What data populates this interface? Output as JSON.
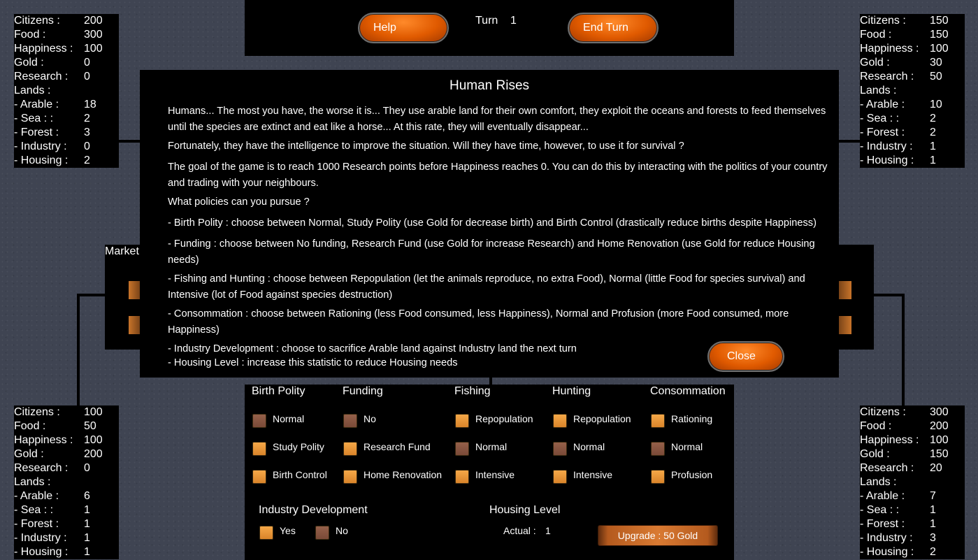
{
  "top": {
    "help_label": "Help",
    "turn_label": "Turn",
    "turn_value": "1",
    "end_turn_label": "End Turn"
  },
  "panels": {
    "top_left": {
      "rows": [
        {
          "k": "Citizens :",
          "v": "200"
        },
        {
          "k": "Food :",
          "v": "300"
        },
        {
          "k": "Happiness :",
          "v": "100"
        },
        {
          "k": "Gold :",
          "v": "0"
        },
        {
          "k": "Research :",
          "v": "0"
        },
        {
          "k": "Lands :",
          "v": ""
        },
        {
          "k": "- Arable :",
          "v": "18"
        },
        {
          "k": "- Sea : :",
          "v": "2"
        },
        {
          "k": "- Forest :",
          "v": "3"
        },
        {
          "k": "- Industry :",
          "v": "0"
        },
        {
          "k": "- Housing :",
          "v": "2"
        }
      ]
    },
    "top_right": {
      "rows": [
        {
          "k": "Citizens :",
          "v": "150"
        },
        {
          "k": "Food :",
          "v": "150"
        },
        {
          "k": "Happiness :",
          "v": "100"
        },
        {
          "k": "Gold :",
          "v": "30"
        },
        {
          "k": "Research :",
          "v": "50"
        },
        {
          "k": "Lands :",
          "v": ""
        },
        {
          "k": "- Arable :",
          "v": "10"
        },
        {
          "k": "- Sea : :",
          "v": "2"
        },
        {
          "k": "- Forest :",
          "v": "2"
        },
        {
          "k": "- Industry :",
          "v": "1"
        },
        {
          "k": "- Housing :",
          "v": "1"
        }
      ]
    },
    "bottom_left": {
      "rows": [
        {
          "k": "Citizens :",
          "v": "100"
        },
        {
          "k": "Food :",
          "v": "50"
        },
        {
          "k": "Happiness :",
          "v": "100"
        },
        {
          "k": "Gold :",
          "v": "200"
        },
        {
          "k": "Research :",
          "v": "0"
        },
        {
          "k": "Lands :",
          "v": ""
        },
        {
          "k": "- Arable :",
          "v": "6"
        },
        {
          "k": "- Sea : :",
          "v": "1"
        },
        {
          "k": "- Forest :",
          "v": "1"
        },
        {
          "k": "- Industry :",
          "v": "1"
        },
        {
          "k": "- Housing :",
          "v": "1"
        }
      ]
    },
    "bottom_right": {
      "rows": [
        {
          "k": "Citizens :",
          "v": "300"
        },
        {
          "k": "Food :",
          "v": "200"
        },
        {
          "k": "Happiness :",
          "v": "100"
        },
        {
          "k": "Gold :",
          "v": "150"
        },
        {
          "k": "Research :",
          "v": "20"
        },
        {
          "k": "Lands :",
          "v": ""
        },
        {
          "k": "- Arable :",
          "v": "7"
        },
        {
          "k": "- Sea : :",
          "v": "1"
        },
        {
          "k": "- Forest :",
          "v": "1"
        },
        {
          "k": "- Industry :",
          "v": "3"
        },
        {
          "k": "- Housing :",
          "v": "2"
        }
      ]
    }
  },
  "market": {
    "label": "Market"
  },
  "modal": {
    "title": "Human Rises",
    "p1": "Humans... The most you have, the worse it is... They use arable land for their own comfort, they exploit the oceans and forests to feed themselves until the species are extinct and eat like a horse... At this rate, they will eventually disappear...",
    "p2": "Fortunately, they have the intelligence to improve the situation. Will they have time, however, to use it for survival ?",
    "p3": "The goal of the game is to reach 1000 Research points before Happiness reaches 0. You can do this by interacting with the politics of your country and trading with your neighbours.",
    "p4": "What policies can you pursue ?",
    "p5": "- Birth Polity : choose between Normal, Study Polity (use Gold for decrease birth) and Birth Control (drastically reduce births despite Happiness)",
    "p6": "- Funding : choose between No funding, Research Fund (use Gold for increase Research) and Home Renovation (use Gold for reduce Housing needs)",
    "p7": "- Fishing and Hunting : choose between Repopulation (let the animals reproduce, no extra Food), Normal (little Food for species survival) and Intensive (lot of Food against species destruction)",
    "p8": "- Consommation : choose between Rationing (less Food consumed, less Happiness), Normal and Profusion (more Food consumed, more Happiness)",
    "p9": "- Industry Development : choose to sacrifice Arable land against Industry land the next turn",
    "p10": "- Housing Level : increase this statistic to reduce Housing needs",
    "close_label": "Close"
  },
  "policies": {
    "birth": {
      "title": "Birth Polity",
      "options": [
        "Normal",
        "Study Polity",
        "Birth Control"
      ]
    },
    "funding": {
      "title": "Funding",
      "options": [
        "No",
        "Research Fund",
        "Home Renovation"
      ]
    },
    "fishing": {
      "title": "Fishing",
      "options": [
        "Repopulation",
        "Normal",
        "Intensive"
      ]
    },
    "hunting": {
      "title": "Hunting",
      "options": [
        "Repopulation",
        "Normal",
        "Intensive"
      ]
    },
    "consommation": {
      "title": "Consommation",
      "options": [
        "Rationing",
        "Normal",
        "Profusion"
      ]
    },
    "industry": {
      "title": "Industry Development",
      "yes": "Yes",
      "no": "No"
    },
    "housing": {
      "title": "Housing Level",
      "actual_label": "Actual :",
      "actual_value": "1",
      "upgrade_label": "Upgrade : 50 Gold"
    }
  },
  "colors": {
    "checkbox_unselected": "#d9842a",
    "checkbox_selected": "#7a4a38",
    "button_orange": "#e05a00"
  }
}
